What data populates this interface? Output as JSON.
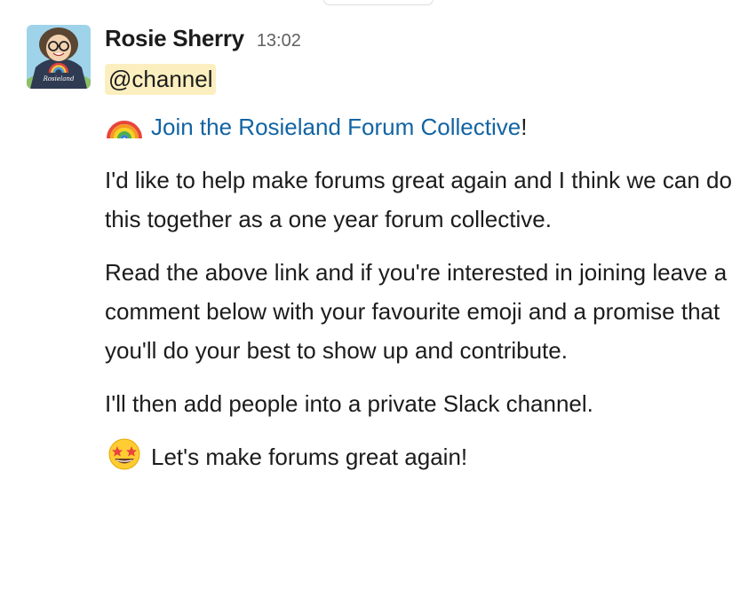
{
  "message": {
    "sender": "Rosie Sherry",
    "time": "13:02",
    "mention": "@channel",
    "avatar": {
      "icon": "avatar-rosie-illustration",
      "shirt_text": "Rosieland"
    },
    "link_line": {
      "emoji": "rainbow-emoji",
      "link_text": "Join the Rosieland Forum Collective",
      "suffix": "!"
    },
    "paragraph1": "I'd like to help make forums great again and I think we can do this together as a one year forum collective.",
    "paragraph2": "Read the above link and if you're interested in joining leave a comment below with your favourite emoji and a promise that you'll do your best to show up and contribute.",
    "paragraph3": "I'll then add people into a private Slack channel.",
    "closing_line": {
      "emoji": "star-struck-emoji",
      "text": "Let's make forums great again!"
    }
  },
  "colors": {
    "link": "#1264a3",
    "mention_bg": "#fcefbf",
    "timestamp": "#616061",
    "text": "#1d1c1d"
  }
}
